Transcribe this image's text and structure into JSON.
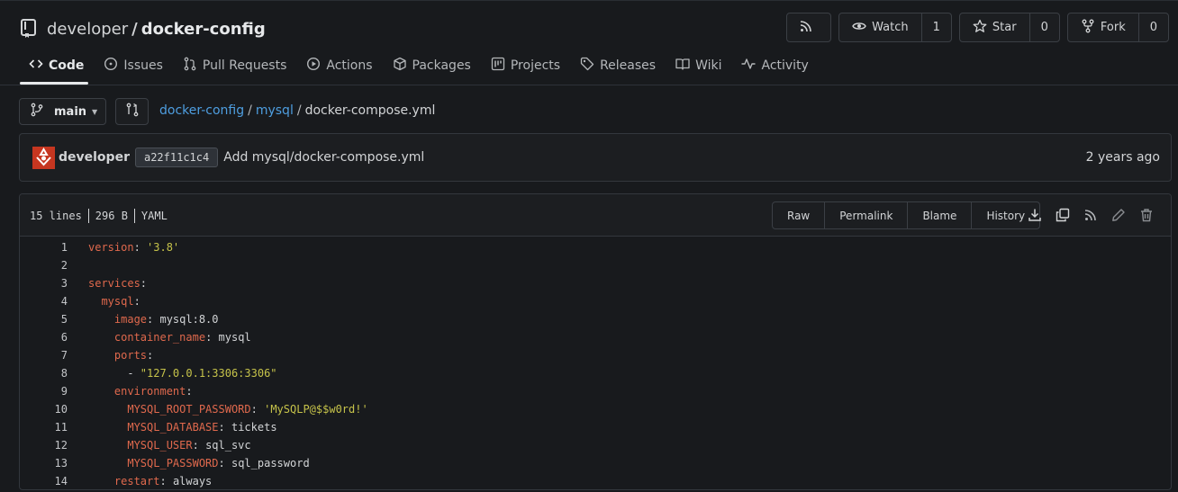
{
  "repo": {
    "owner": "developer",
    "separator": "/",
    "name": "docker-config"
  },
  "actions": {
    "watch_label": "Watch",
    "watch_count": "1",
    "star_label": "Star",
    "star_count": "0",
    "fork_label": "Fork",
    "fork_count": "0"
  },
  "tabs": [
    {
      "label": "Code",
      "icon": "code-icon"
    },
    {
      "label": "Issues",
      "icon": "issue-icon"
    },
    {
      "label": "Pull Requests",
      "icon": "pull-request-icon"
    },
    {
      "label": "Actions",
      "icon": "play-icon"
    },
    {
      "label": "Packages",
      "icon": "package-icon"
    },
    {
      "label": "Projects",
      "icon": "project-icon"
    },
    {
      "label": "Releases",
      "icon": "tag-icon"
    },
    {
      "label": "Wiki",
      "icon": "book-icon"
    },
    {
      "label": "Activity",
      "icon": "pulse-icon"
    }
  ],
  "branch": {
    "name": "main"
  },
  "breadcrumb": {
    "root": "docker-config",
    "dir": "mysql",
    "file": "docker-compose.yml",
    "sep": "/"
  },
  "commit": {
    "author": "developer",
    "sha": "a22f11c1c4",
    "message": "Add mysql/docker-compose.yml",
    "time": "2 years ago"
  },
  "file": {
    "lines_info": "15 lines",
    "size_info": "296 B",
    "lang_info": "YAML",
    "buttons": {
      "raw": "Raw",
      "permalink": "Permalink",
      "blame": "Blame",
      "history": "History"
    }
  },
  "code": [
    {
      "n": "1",
      "indent": "",
      "key": "version",
      "sep": ": ",
      "val": "'3.8'",
      "valType": "s"
    },
    {
      "n": "2",
      "indent": "",
      "key": "",
      "sep": "",
      "val": "",
      "valType": "p"
    },
    {
      "n": "3",
      "indent": "",
      "key": "services",
      "sep": ":",
      "val": "",
      "valType": "p"
    },
    {
      "n": "4",
      "indent": "  ",
      "key": "mysql",
      "sep": ":",
      "val": "",
      "valType": "p"
    },
    {
      "n": "5",
      "indent": "    ",
      "key": "image",
      "sep": ": ",
      "val": "mysql:8.0",
      "valType": "p"
    },
    {
      "n": "6",
      "indent": "    ",
      "key": "container_name",
      "sep": ": ",
      "val": "mysql",
      "valType": "p"
    },
    {
      "n": "7",
      "indent": "    ",
      "key": "ports",
      "sep": ":",
      "val": "",
      "valType": "p"
    },
    {
      "n": "8",
      "indent": "      - ",
      "key": "",
      "sep": "",
      "val": "\"127.0.0.1:3306:3306\"",
      "valType": "s"
    },
    {
      "n": "9",
      "indent": "    ",
      "key": "environment",
      "sep": ":",
      "val": "",
      "valType": "p"
    },
    {
      "n": "10",
      "indent": "      ",
      "key": "MYSQL_ROOT_PASSWORD",
      "sep": ": ",
      "val": "'MySQLP@$$w0rd!'",
      "valType": "s"
    },
    {
      "n": "11",
      "indent": "      ",
      "key": "MYSQL_DATABASE",
      "sep": ": ",
      "val": "tickets",
      "valType": "p"
    },
    {
      "n": "12",
      "indent": "      ",
      "key": "MYSQL_USER",
      "sep": ": ",
      "val": "sql_svc",
      "valType": "p"
    },
    {
      "n": "13",
      "indent": "      ",
      "key": "MYSQL_PASSWORD",
      "sep": ": ",
      "val": "sql_password",
      "valType": "p"
    },
    {
      "n": "14",
      "indent": "    ",
      "key": "restart",
      "sep": ": ",
      "val": "always",
      "valType": "p"
    }
  ],
  "colors": {
    "accent_link": "#4e9ee0",
    "yaml_key": "#e0694d",
    "yaml_string": "#c6c34a",
    "avatar": "#c63620"
  }
}
